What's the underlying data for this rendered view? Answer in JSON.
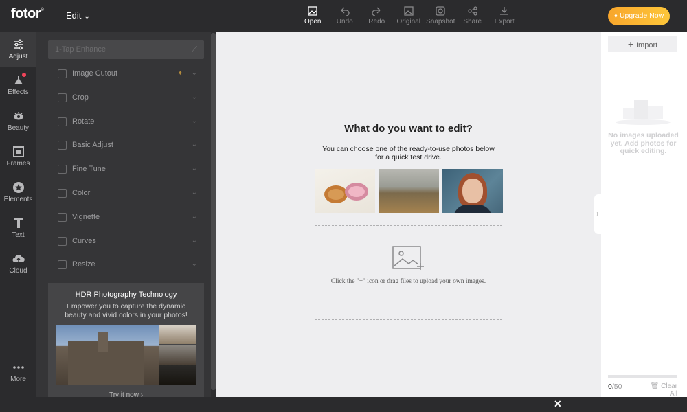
{
  "app": {
    "logo": "fotor",
    "logo_mark": "®",
    "edit_menu": "Edit"
  },
  "toolbar": {
    "items": [
      {
        "label": "Open",
        "icon": "image-open-icon"
      },
      {
        "label": "Undo",
        "icon": "undo-icon"
      },
      {
        "label": "Redo",
        "icon": "redo-icon"
      },
      {
        "label": "Original",
        "icon": "original-icon"
      },
      {
        "label": "Snapshot",
        "icon": "snapshot-icon"
      },
      {
        "label": "Share",
        "icon": "share-icon"
      },
      {
        "label": "Export",
        "icon": "export-icon"
      }
    ],
    "upgrade": "Upgrade Now"
  },
  "rail": {
    "items": [
      {
        "label": "Adjust",
        "icon": "sliders-icon"
      },
      {
        "label": "Effects",
        "icon": "flask-icon"
      },
      {
        "label": "Beauty",
        "icon": "eye-icon"
      },
      {
        "label": "Frames",
        "icon": "frame-icon"
      },
      {
        "label": "Elements",
        "icon": "star-icon"
      },
      {
        "label": "Text",
        "icon": "text-icon"
      },
      {
        "label": "Cloud",
        "icon": "cloud-icon"
      },
      {
        "label": "More",
        "icon": "more-icon"
      }
    ]
  },
  "panel": {
    "enhance": "1-Tap Enhance",
    "items": [
      {
        "label": "Image Cutout",
        "icon": "cutout-icon"
      },
      {
        "label": "Crop",
        "icon": "crop-icon"
      },
      {
        "label": "Rotate",
        "icon": "rotate-icon"
      },
      {
        "label": "Basic Adjust",
        "icon": "basic-adjust-icon"
      },
      {
        "label": "Fine Tune",
        "icon": "fine-tune-icon"
      },
      {
        "label": "Color",
        "icon": "color-icon"
      },
      {
        "label": "Vignette",
        "icon": "vignette-icon"
      },
      {
        "label": "Curves",
        "icon": "curves-icon"
      },
      {
        "label": "Resize",
        "icon": "resize-icon"
      }
    ],
    "promo": {
      "title": "HDR Photography Technology",
      "desc": "Empower you to capture the dynamic beauty and vivid colors in your photos!",
      "link": "Try it now"
    }
  },
  "canvas": {
    "title": "What do you want to edit?",
    "subtitle": "You can choose one of the ready-to-use photos below for a quick test drive.",
    "drop_text": "Click the \"+\" icon or drag files to upload your own images."
  },
  "right": {
    "import": "Import",
    "empty": "No images uploaded yet. Add photos for quick editing.",
    "count": "0",
    "total": "/50",
    "clear": "Clear All"
  },
  "colors": {
    "accent": "#fdb930",
    "badge": "#f0445a"
  }
}
